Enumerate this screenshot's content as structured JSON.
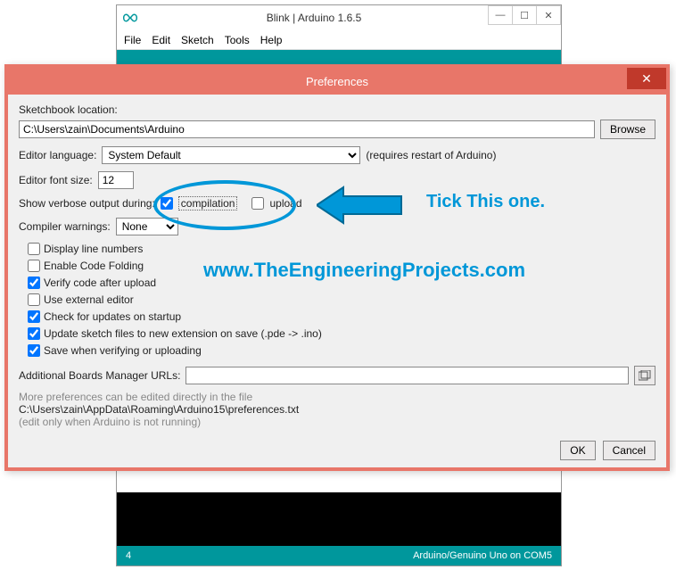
{
  "arduino": {
    "title": "Blink | Arduino 1.6.5",
    "menu": {
      "file": "File",
      "edit": "Edit",
      "sketch": "Sketch",
      "tools": "Tools",
      "help": "Help"
    },
    "status_left": "4",
    "status_right": "Arduino/Genuino Uno on COM5"
  },
  "pref": {
    "title": "Preferences",
    "sketchbook_label": "Sketchbook location:",
    "sketchbook_value": "C:\\Users\\zain\\Documents\\Arduino",
    "browse": "Browse",
    "editor_lang_label": "Editor language:",
    "editor_lang_value": "System Default",
    "restart_note": "(requires restart of Arduino)",
    "font_size_label": "Editor font size:",
    "font_size_value": "12",
    "verbose_label": "Show verbose output during:",
    "compilation_label": "compilation",
    "upload_label": "upload",
    "compiler_warn_label": "Compiler warnings:",
    "compiler_warn_value": "None",
    "checks": [
      {
        "label": "Display line numbers",
        "checked": false
      },
      {
        "label": "Enable Code Folding",
        "checked": false
      },
      {
        "label": "Verify code after upload",
        "checked": true
      },
      {
        "label": "Use external editor",
        "checked": false
      },
      {
        "label": "Check for updates on startup",
        "checked": true
      },
      {
        "label": "Update sketch files to new extension on save (.pde -> .ino)",
        "checked": true
      },
      {
        "label": "Save when verifying or uploading",
        "checked": true
      }
    ],
    "abm_label": "Additional Boards Manager URLs:",
    "abm_value": "",
    "more_note": "More preferences can be edited directly in the file",
    "pref_path": "C:\\Users\\zain\\AppData\\Roaming\\Arduino15\\preferences.txt",
    "edit_note": "(edit only when Arduino is not running)",
    "ok": "OK",
    "cancel": "Cancel"
  },
  "annot": {
    "tick": "Tick This one.",
    "watermark": "www.TheEngineeringProjects.com"
  }
}
